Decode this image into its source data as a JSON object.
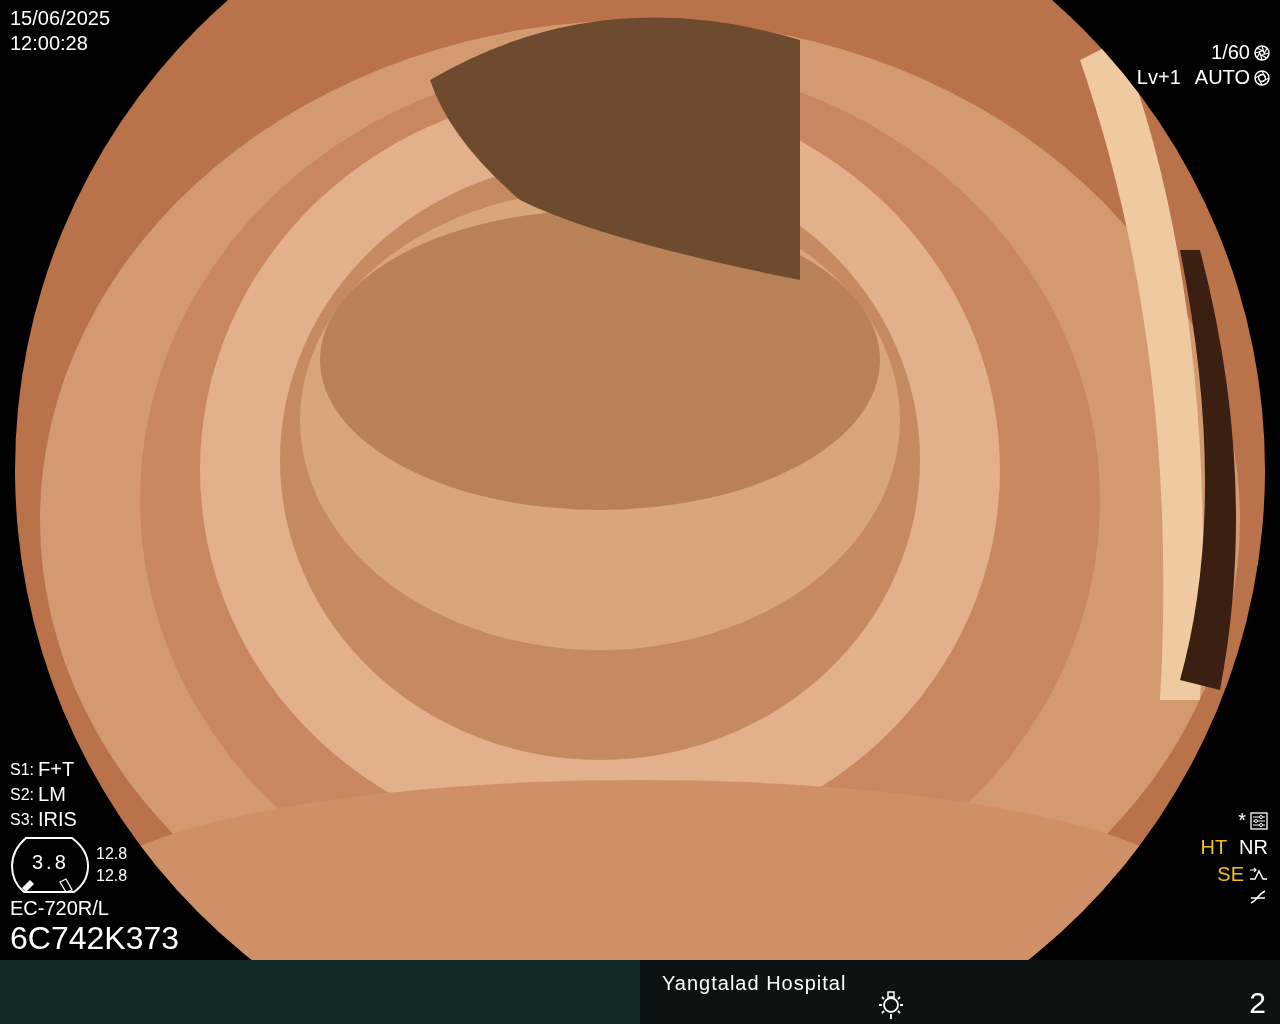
{
  "timestamp": {
    "date": "15/06/2025",
    "time": "12:00:28"
  },
  "exposure": {
    "shutter": "1/60",
    "level": "Lv+1",
    "iris_mode": "AUTO"
  },
  "switches": [
    {
      "label": "S1:",
      "value": "F+T"
    },
    {
      "label": "S2:",
      "value": "LM"
    },
    {
      "label": "S3:",
      "value": "IRIS"
    }
  ],
  "gauge": {
    "value": "3.8",
    "readings": [
      "12.8",
      "12.8"
    ]
  },
  "scope": {
    "model": "EC-720R/L",
    "serial": "6C742K373"
  },
  "marker": "*",
  "enhancements": [
    {
      "text": "HT",
      "on": true
    },
    {
      "text": "NR",
      "on": false
    },
    {
      "text": "SE",
      "on": true
    }
  ],
  "footer": {
    "hospital": "Yangtalad Hospital",
    "page": "2"
  }
}
